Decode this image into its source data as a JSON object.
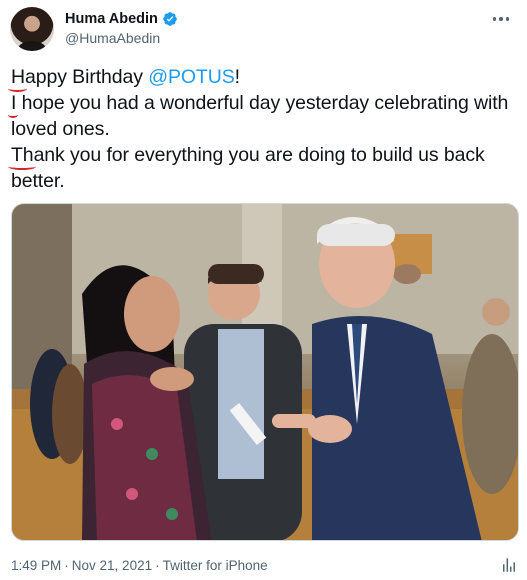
{
  "author": {
    "display_name": "Huma Abedin",
    "handle": "@HumaAbedin",
    "verified": true
  },
  "tweet": {
    "line1_first": "H",
    "line1_rest": "appy Birthday ",
    "mention": "@POTUS",
    "line1_end": "!",
    "line2_first": "I",
    "line2_rest": " hope you had a wonderful day yesterday celebrating with loved ones.",
    "line3_first": "Th",
    "line3_rest": "ank you for everything you are doing to build us back better."
  },
  "meta": {
    "time": "1:49 PM",
    "date": "Nov 21, 2021",
    "source": "Twitter for iPhone",
    "separator": "·"
  },
  "icons": {
    "verified": "verified-badge-icon",
    "more": "more-icon",
    "analytics": "analytics-icon"
  },
  "colors": {
    "link": "#1d9bf0",
    "secondary_text": "#536471",
    "annotation": "#d3262f"
  }
}
